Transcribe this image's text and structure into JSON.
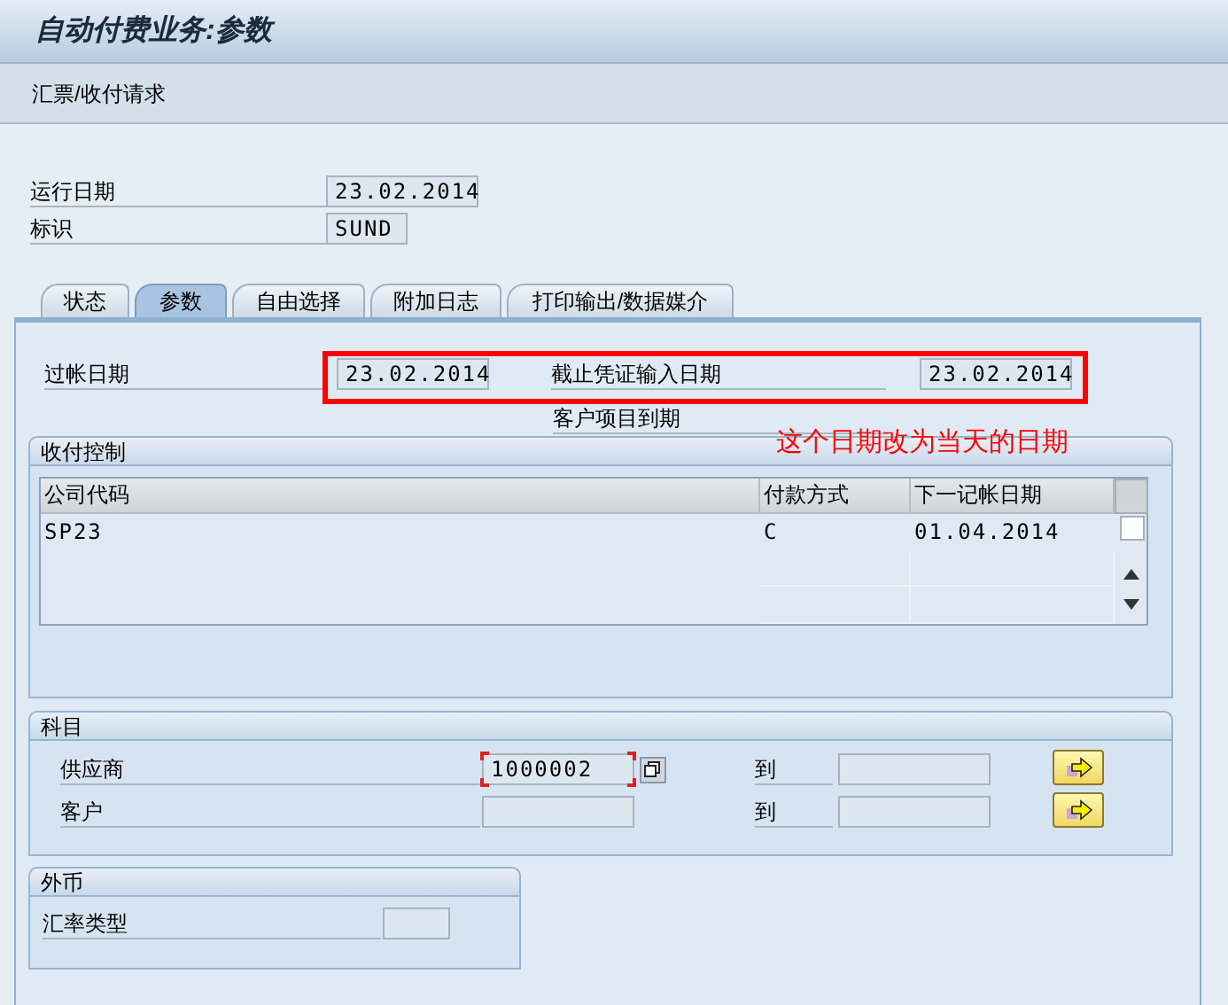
{
  "window": {
    "title": "自动付费业务:参数"
  },
  "toolbar": {
    "items": [
      {
        "label": "汇票/收付请求"
      }
    ]
  },
  "header_fields": [
    {
      "label": "运行日期",
      "value": "23.02.2014"
    },
    {
      "label": "标识",
      "value": "SUND"
    }
  ],
  "tabs": [
    {
      "label": "状态",
      "selected": false
    },
    {
      "label": "参数",
      "selected": true
    },
    {
      "label": "自由选择",
      "selected": false
    },
    {
      "label": "附加日志",
      "selected": false
    },
    {
      "label": "打印输出/数据媒介",
      "selected": false
    }
  ],
  "parameters": {
    "posting_date": {
      "label": "过帐日期",
      "value": "23.02.2014"
    },
    "doc_entry_date": {
      "label": "截止凭证输入日期",
      "value": "23.02.2014"
    },
    "customer_due": {
      "label": "客户项目到期"
    }
  },
  "annotation": {
    "text": "这个日期改为当天的日期"
  },
  "payment_control": {
    "title": "收付控制",
    "table": {
      "columns": [
        "公司代码",
        "付款方式",
        "下一记帐日期"
      ],
      "rows": [
        {
          "cells": [
            "SP23",
            "C",
            "01.04.2014"
          ],
          "selected": false
        }
      ]
    }
  },
  "accounts": {
    "title": "科目",
    "rows": [
      {
        "label": "供应商",
        "from": "1000002",
        "to_label": "到",
        "focused": true
      },
      {
        "label": "客户",
        "to_label": "到",
        "focused": false
      }
    ]
  },
  "foreign_currency": {
    "title": "外币",
    "fields": [
      {
        "label": "汇率类型"
      }
    ]
  }
}
